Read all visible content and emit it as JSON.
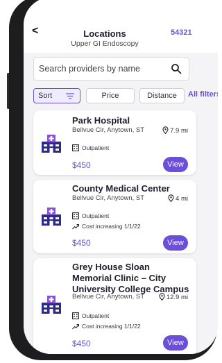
{
  "header": {
    "back_glyph": "<",
    "title": "Locations",
    "subtitle": "Upper GI Endoscopy",
    "zip": "54321"
  },
  "search": {
    "placeholder": "Search providers by name"
  },
  "filters": {
    "sort": "Sort",
    "price": "Price",
    "distance": "Distance",
    "all": "All filters"
  },
  "results": [
    {
      "name": "Park Hospital",
      "address": "Bellvue Cir, Anytown, ST",
      "distance": "7.9 mi",
      "tags": [
        "Outpatient"
      ],
      "price": "$450",
      "action": "View"
    },
    {
      "name": "County Medical Center",
      "address": "Bellvue Cir, Anytown, ST",
      "distance": "4 mi",
      "tags": [
        "Outpatient",
        "Cost increasing 1/1/22"
      ],
      "price": "$450",
      "action": "View"
    },
    {
      "name": "Grey House Sloan Memorial Clinic – City University College Campus",
      "address": "Bellvue Cir, Anytown, ST",
      "distance": "12.9 mi",
      "tags": [
        "Outpatient",
        "Cost increasing 1/1/22"
      ],
      "price": "$450",
      "action": "View"
    }
  ],
  "colors": {
    "accent": "#6b4fd8",
    "background": "#f4f4f6",
    "frame": "#1d1d1f"
  }
}
